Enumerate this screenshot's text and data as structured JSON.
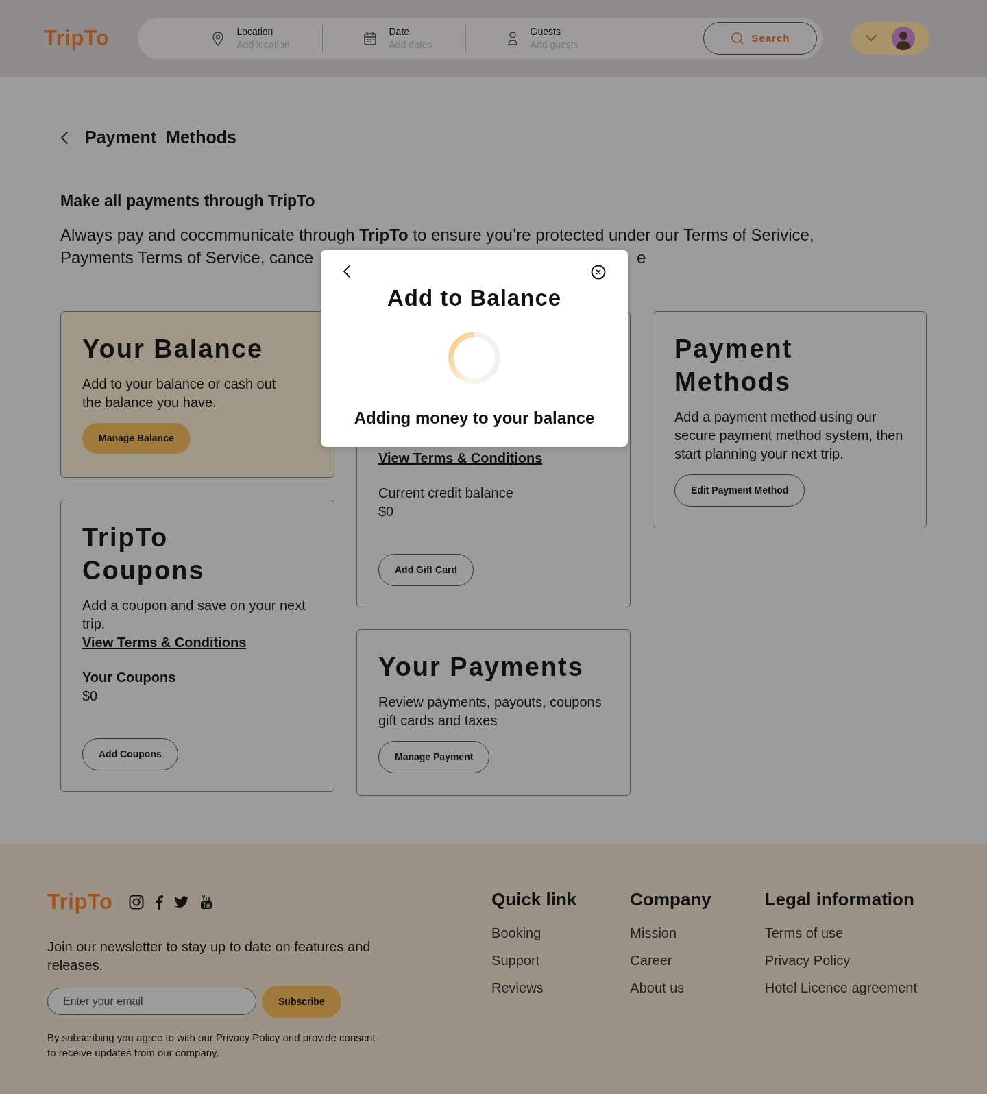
{
  "header": {
    "logo": "TripTo",
    "fields": [
      {
        "kind": "location",
        "label": "Location",
        "placeholder": "Add location"
      },
      {
        "kind": "date",
        "label": "Date",
        "placeholder": "Add dates"
      },
      {
        "kind": "guests",
        "label": "Guests",
        "placeholder": "Add guests"
      }
    ],
    "search_button": "Search"
  },
  "page": {
    "title": "Payment  Methods",
    "intro_heading": "Make all payments through **TripTo**",
    "notice_line_1": "Always pay and coccmmunicate through **TripTo** to ensure you’re protected under our Terms of Serivice,",
    "notice_line_2_left": "Payments Terms of Service, cance",
    "notice_line_2_right": "e"
  },
  "columns": [
    {
      "cards": [
        {
          "kind": "info",
          "highlighted": true,
          "title": "Your Balance",
          "description": "Add to your balance or cash out the balance you have.",
          "button": "Manage Balance"
        },
        {
          "kind": "coupons",
          "highlighted": false,
          "title": "TripTo Coupons",
          "description": "Add a coupon and save on your next trip.",
          "link": "View Terms & Conditions",
          "amount_label": "Your Coupons",
          "amount": "$0",
          "button": "Add Coupons"
        }
      ]
    },
    {
      "cards": [
        {
          "kind": "gift",
          "highlighted": false,
          "link": "View Terms & Conditions",
          "amount_label": "Current credit balance",
          "amount": "$0",
          "button": "Add Gift Card"
        },
        {
          "kind": "info",
          "highlighted": false,
          "title": "Your Payments",
          "description": "Review payments, payouts, coupons gift cards and taxes",
          "button": "Manage Payment"
        }
      ]
    },
    {
      "cards": [
        {
          "kind": "info",
          "highlighted": false,
          "title": "Payment Methods",
          "description": "Add a payment method using our secure payment method system, then start planning your next trip.",
          "button": "Edit Payment Method"
        }
      ]
    }
  ],
  "modal": {
    "title": "Add to Balance",
    "message": "Adding money to your balance"
  },
  "footer": {
    "logo": "TripTo",
    "newsletter": "Join our newsletter to stay up to date on features and releases.",
    "email_placeholder": "Enter your email",
    "subscribe_button": "Subscribe",
    "disclaimer": "By subscribing you agree to with our Privacy Policy and provide consent to receive updates from our company.",
    "link_columns": [
      {
        "heading": "Quick link",
        "links": [
          "Booking",
          "Support",
          "Reviews"
        ]
      },
      {
        "heading": "Company",
        "links": [
          "Mission",
          "Career",
          "About us"
        ]
      },
      {
        "heading": "Legal information",
        "links": [
          "Terms of use",
          "Privacy Policy",
          "Hotel Licence agreement"
        ]
      }
    ]
  }
}
